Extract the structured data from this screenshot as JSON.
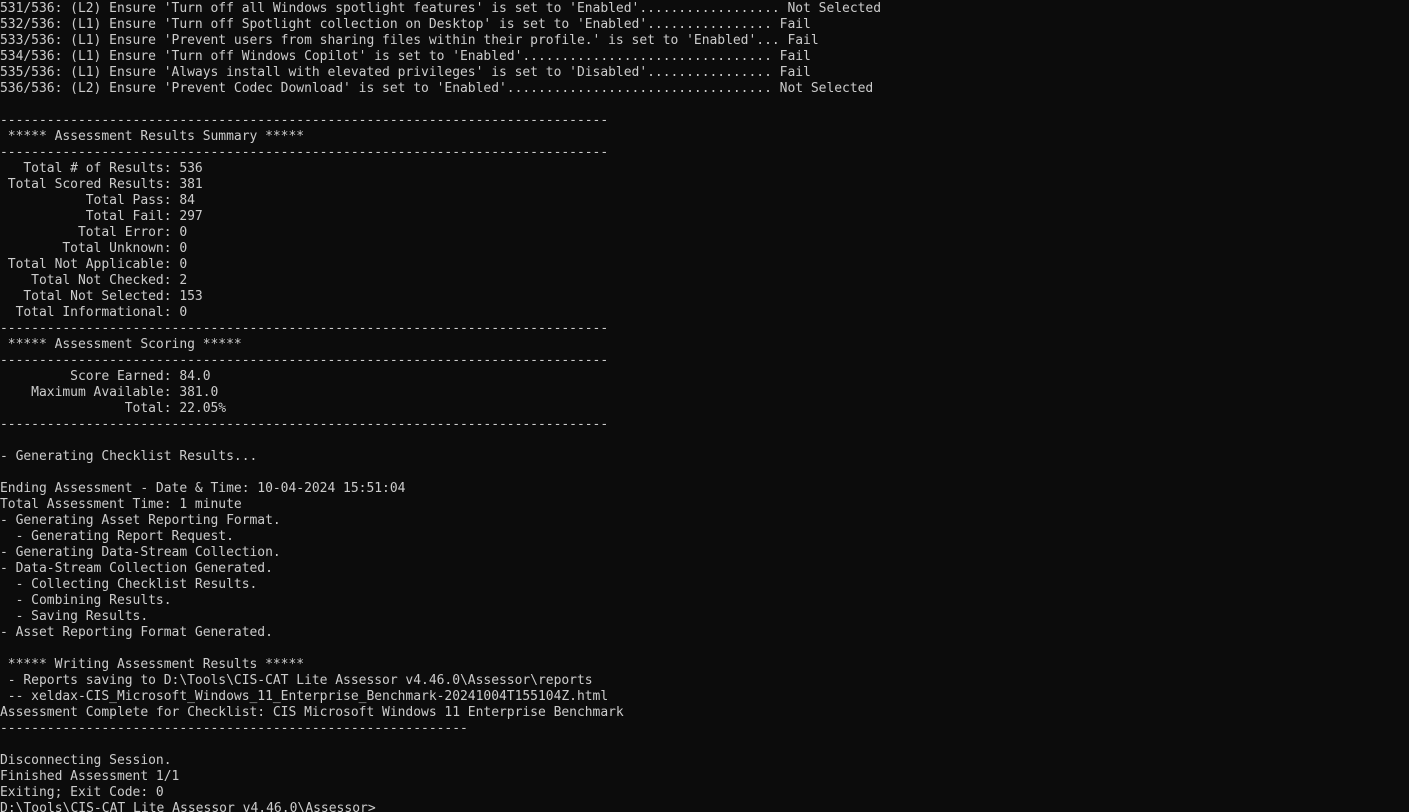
{
  "terminal": {
    "lines": [
      "531/536: (L2) Ensure 'Turn off all Windows spotlight features' is set to 'Enabled'.................. Not Selected",
      "532/536: (L1) Ensure 'Turn off Spotlight collection on Desktop' is set to 'Enabled'................ Fail",
      "533/536: (L1) Ensure 'Prevent users from sharing files within their profile.' is set to 'Enabled'... Fail",
      "534/536: (L1) Ensure 'Turn off Windows Copilot' is set to 'Enabled'................................ Fail",
      "535/536: (L1) Ensure 'Always install with elevated privileges' is set to 'Disabled'................ Fail",
      "536/536: (L2) Ensure 'Prevent Codec Download' is set to 'Enabled'.................................. Not Selected",
      "",
      "------------------------------------------------------------------------------",
      " ***** Assessment Results Summary *****",
      "------------------------------------------------------------------------------",
      "   Total # of Results: 536",
      " Total Scored Results: 381",
      "           Total Pass: 84",
      "           Total Fail: 297",
      "          Total Error: 0",
      "        Total Unknown: 0",
      " Total Not Applicable: 0",
      "    Total Not Checked: 2",
      "   Total Not Selected: 153",
      "  Total Informational: 0",
      "------------------------------------------------------------------------------",
      " ***** Assessment Scoring *****",
      "------------------------------------------------------------------------------",
      "         Score Earned: 84.0",
      "    Maximum Available: 381.0",
      "                Total: 22.05%",
      "------------------------------------------------------------------------------",
      "",
      "- Generating Checklist Results...",
      "",
      "Ending Assessment - Date & Time: 10-04-2024 15:51:04",
      "Total Assessment Time: 1 minute",
      "- Generating Asset Reporting Format.",
      "  - Generating Report Request.",
      "- Generating Data-Stream Collection.",
      "- Data-Stream Collection Generated.",
      "  - Collecting Checklist Results.",
      "  - Combining Results.",
      "  - Saving Results.",
      "- Asset Reporting Format Generated.",
      "",
      " ***** Writing Assessment Results *****",
      " - Reports saving to D:\\Tools\\CIS-CAT Lite Assessor v4.46.0\\Assessor\\reports",
      " -- xeldax-CIS_Microsoft_Windows_11_Enterprise_Benchmark-20241004T155104Z.html",
      "Assessment Complete for Checklist: CIS Microsoft Windows 11 Enterprise Benchmark",
      "------------------------------------------------------------",
      "",
      "Disconnecting Session.",
      "Finished Assessment 1/1",
      "Exiting; Exit Code: 0"
    ],
    "prompt": "D:\\Tools\\CIS-CAT Lite Assessor v4.46.0\\Assessor>"
  }
}
